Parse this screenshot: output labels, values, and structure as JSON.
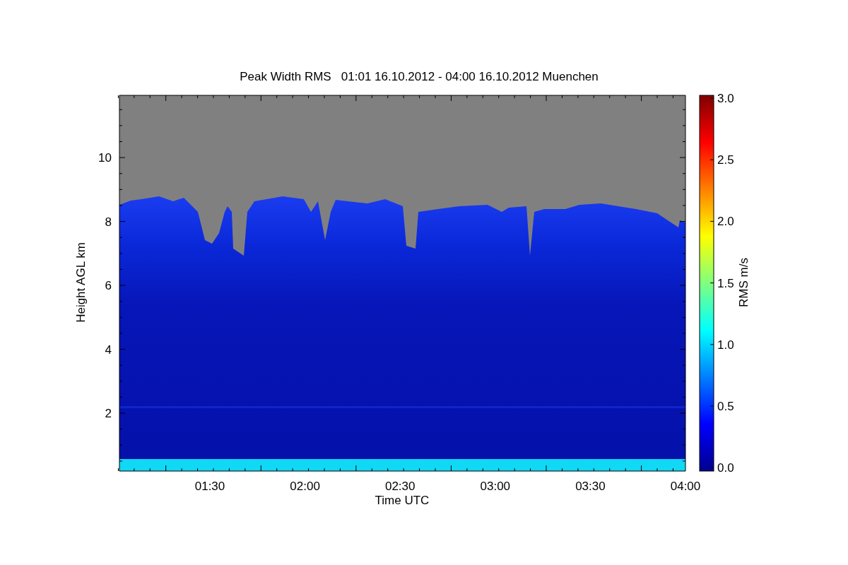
{
  "title": "Peak Width RMS   01:01 16.10.2012 - 04:00 16.10.2012 Muenchen",
  "plot": {
    "xlabel": "Time UTC",
    "ylabel": "Height AGL km",
    "xticks": [
      "01:30",
      "02:00",
      "02:30",
      "03:00",
      "03:30",
      "04:00"
    ],
    "yticks": [
      "10",
      "8",
      "6",
      "4",
      "2"
    ]
  },
  "colorbar": {
    "label": "RMS m/s",
    "ticks": [
      "3.0",
      "2.5",
      "2.0",
      "1.5",
      "1.0",
      "0.5",
      "0.0"
    ]
  }
}
